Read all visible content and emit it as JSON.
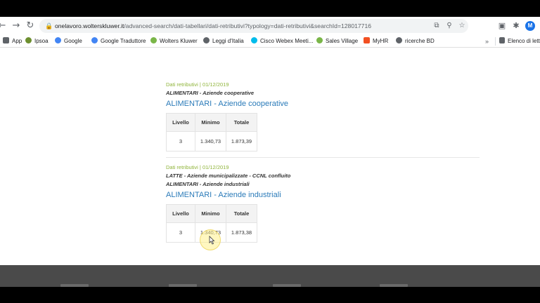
{
  "browser": {
    "url_host": "onelavoro.wolterskluwer.it",
    "url_path": "/advanced-search/dati-tabellari/dati-retributivi?typology=dati-retributivi&searchId=128017716",
    "avatar_letter": "M",
    "nav_icons": [
      "back-icon",
      "forward-icon",
      "reload-icon"
    ],
    "accent_color": "#1a73e8"
  },
  "bookmarks": {
    "items": [
      {
        "label": "App",
        "icon": "apps-icon",
        "color": "#5f6368"
      },
      {
        "label": "Ipsoa",
        "icon": "ipsoa-icon",
        "color": "#6d8f2f"
      },
      {
        "label": "Google",
        "icon": "google-icon",
        "color": "#4285f4"
      },
      {
        "label": "Google Traduttore",
        "icon": "translate-icon",
        "color": "#4285f4"
      },
      {
        "label": "Wolters Kluwer",
        "icon": "wk-icon",
        "color": "#7ab648"
      },
      {
        "label": "Leggi d'Italia",
        "icon": "globe-icon",
        "color": "#5f6368"
      },
      {
        "label": "Cisco Webex Meeti...",
        "icon": "webex-icon",
        "color": "#00bceb"
      },
      {
        "label": "Sales Village",
        "icon": "sales-icon",
        "color": "#7ab648"
      },
      {
        "label": "MyHR",
        "icon": "windows-icon",
        "color": "#f25022"
      },
      {
        "label": "ricerche BD",
        "icon": "globe-icon",
        "color": "#5f6368"
      }
    ],
    "overflow": "»",
    "reading_list": "Elenco di lett"
  },
  "results": [
    {
      "meta": "Dati retributivi | 01/12/2019",
      "subtitles": [
        "ALIMENTARI - Aziende cooperative"
      ],
      "title": "ALIMENTARI - Aziende cooperative",
      "headers": [
        "Livello",
        "Minimo",
        "Totale"
      ],
      "rows": [
        [
          "3",
          "1.340,73",
          "1.873,39"
        ]
      ]
    },
    {
      "meta": "Dati retributivi | 01/12/2019",
      "subtitles": [
        "LATTE - Aziende municipalizzate - CCNL confluito",
        "ALIMENTARI - Aziende industriali"
      ],
      "title": "ALIMENTARI - Aziende industriali",
      "headers": [
        "Livello",
        "Minimo",
        "Totale"
      ],
      "rows": [
        [
          "3",
          "1.340,73",
          "1.873,38"
        ]
      ]
    }
  ]
}
